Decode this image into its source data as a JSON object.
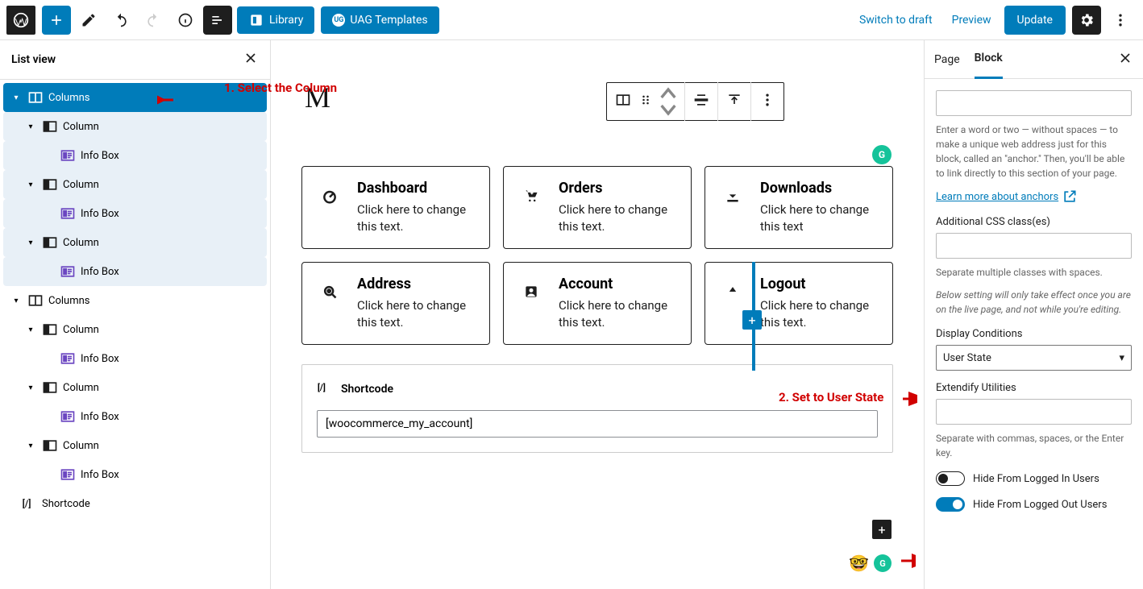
{
  "topbar": {
    "library": "Library",
    "uag": "UAG Templates",
    "switch_draft": "Switch to draft",
    "preview": "Preview",
    "update": "Update"
  },
  "listview": {
    "title": "List view",
    "items": {
      "columns": "Columns",
      "column": "Column",
      "infobox": "Info Box",
      "shortcode": "Shortcode"
    }
  },
  "canvas": {
    "title_ghost": "M",
    "cards": [
      {
        "title": "Dashboard",
        "text": "Click here to change this text."
      },
      {
        "title": "Orders",
        "text": "Click here to change this text."
      },
      {
        "title": "Downloads",
        "text": "Click here to change this text"
      },
      {
        "title": "Address",
        "text": "Click here to change this text."
      },
      {
        "title": "Account",
        "text": "Click here to change this text."
      },
      {
        "title": "Logout",
        "text": "Click here to change this text."
      }
    ],
    "shortcode_label": "Shortcode",
    "shortcode_value": "[woocommerce_my_account]"
  },
  "rside": {
    "tab_page": "Page",
    "tab_block": "Block",
    "anchor_help": "Enter a word or two — without spaces — to make a unique web address just for this block, called an \"anchor.\" Then, you'll be able to link directly to this section of your page.",
    "anchor_link": "Learn more about anchors",
    "css_label": "Additional CSS class(es)",
    "css_help": "Separate multiple classes with spaces.",
    "live_note": "Below setting will only take effect once you are on the live page, and not while you're editing.",
    "display_conditions": "Display Conditions",
    "display_value": "User State",
    "extendify_label": "Extendify Utilities",
    "extendify_help": "Separate with commas, spaces, or the Enter key.",
    "hide_logged_in": "Hide From Logged In Users",
    "hide_logged_out": "Hide From Logged Out Users"
  },
  "annotations": {
    "a1": "1. Select the Column",
    "a2": "2. Set to User State"
  }
}
